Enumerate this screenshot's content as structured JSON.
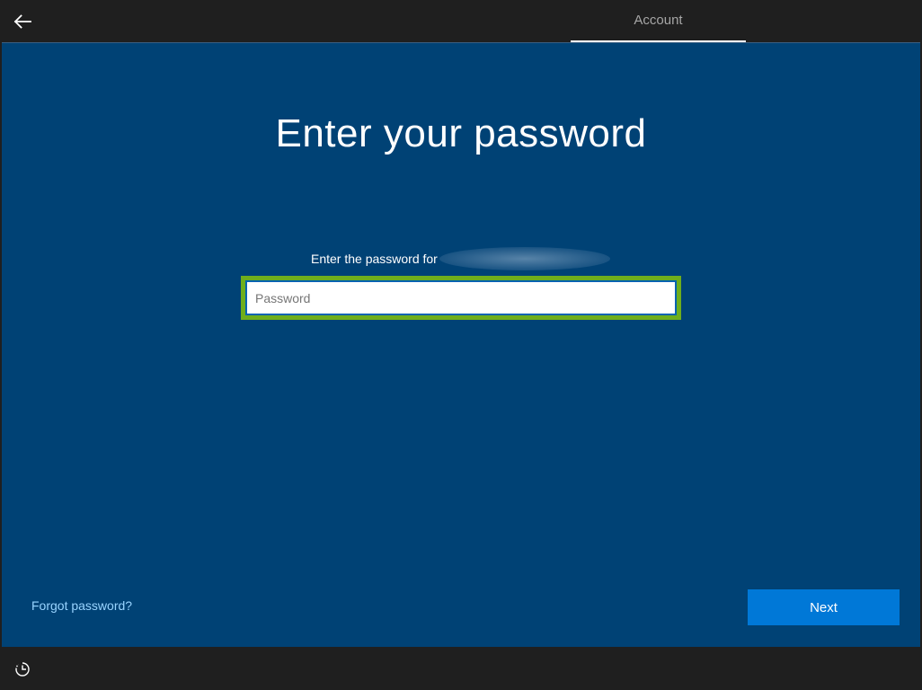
{
  "header": {
    "back_icon": "arrow-left-icon",
    "tabs": [
      {
        "label": "Account",
        "active": true
      }
    ]
  },
  "main": {
    "title": "Enter your password",
    "prompt": "Enter the password for",
    "password": {
      "placeholder": "Password",
      "value": ""
    },
    "forgot_label": "Forgot password?",
    "next_label": "Next"
  },
  "footer": {
    "accessibility_icon": "ease-of-access-icon"
  },
  "colors": {
    "background": "#004275",
    "chrome": "#1f1f1f",
    "accent": "#0078d7",
    "link": "#99d4ff",
    "highlight": "#6fae1c"
  }
}
